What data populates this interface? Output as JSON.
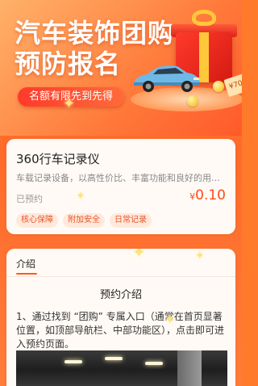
{
  "banner": {
    "title": "汽车装饰团购预防报名",
    "tag": "名额有限先到先得",
    "ticket_text": "¥70"
  },
  "product": {
    "name": "360行车记录仪",
    "description": "车载记录设备，以高性价比、丰富功能和良好的用户体验",
    "status": "已预约",
    "price_currency": "¥",
    "price_value": "0.10",
    "tags": [
      "核心保障",
      "附加安全",
      "日常记录"
    ]
  },
  "intro": {
    "tab_label": "介绍",
    "section_title": "预约介绍",
    "body": "1、通过找到 “团购” 专属入口（通常在首页显著位置，如顶部导航栏、中部功能区），点击即可进入预约页面。"
  },
  "colors": {
    "accent": "#ff5a1a",
    "price": "#ff4a1a",
    "background": "#ff7a2a"
  },
  "icons": [
    "gift-box-icon",
    "car-icon",
    "sparkle-icon",
    "coin-icon"
  ]
}
